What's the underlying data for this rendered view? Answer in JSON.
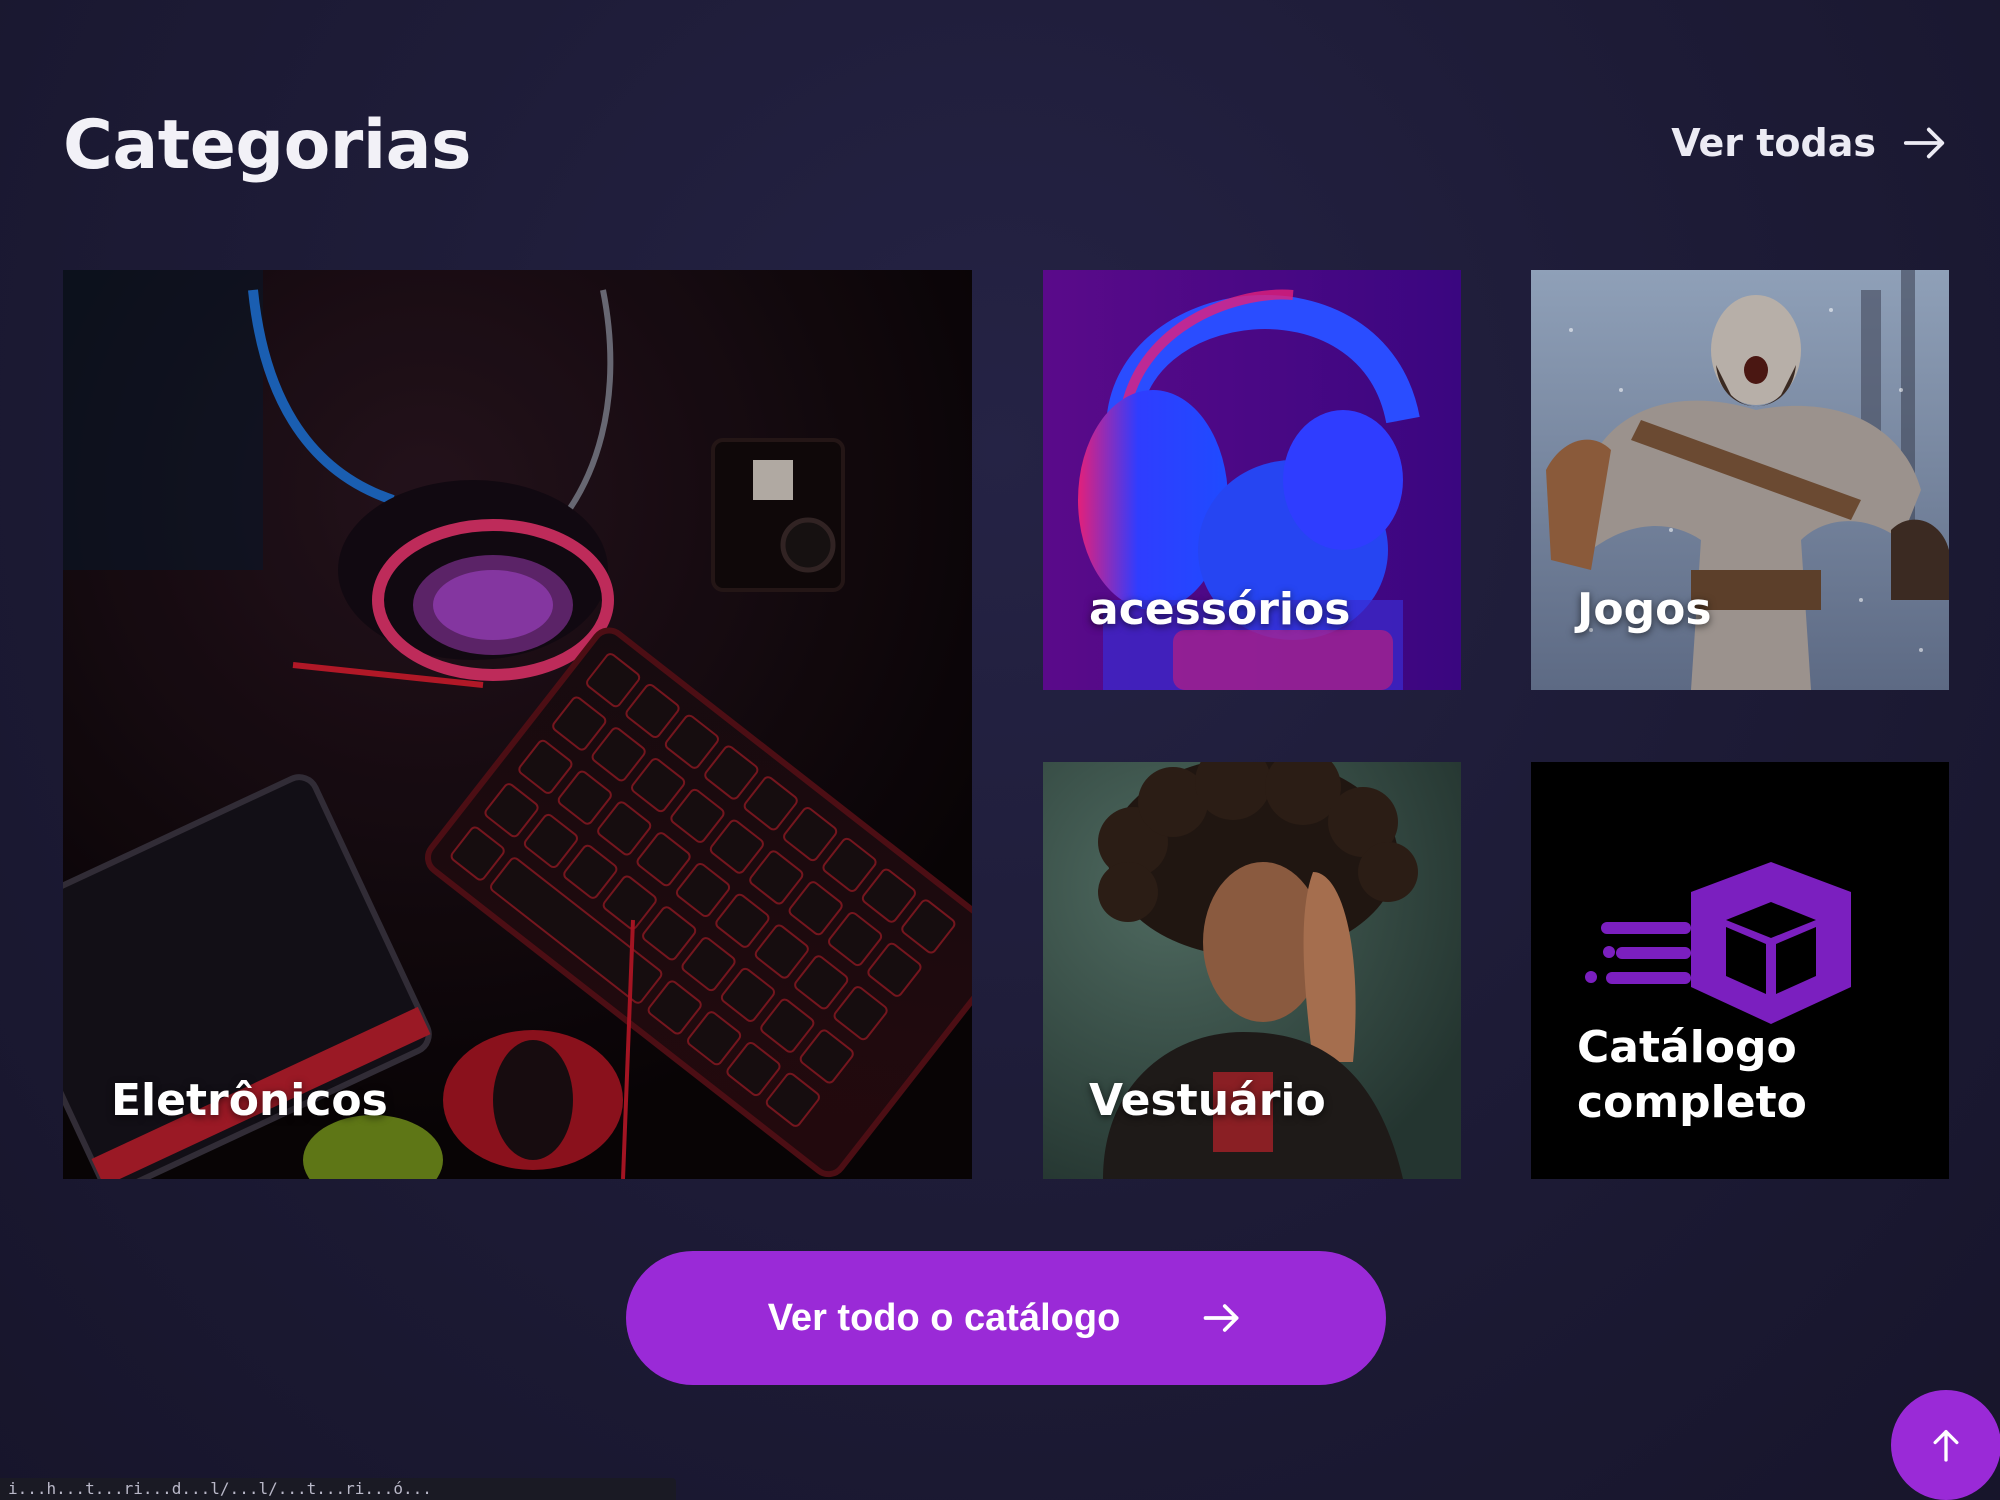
{
  "header": {
    "title": "Categorias",
    "view_all_label": "Ver todas"
  },
  "categories": [
    {
      "label": "Eletrônicos"
    },
    {
      "label": "acessórios"
    },
    {
      "label": "Jogos"
    },
    {
      "label": "Vestuário"
    },
    {
      "label_line1": "Catálogo",
      "label_line2": "completo"
    }
  ],
  "cta": {
    "label": "Ver todo o catálogo"
  },
  "status_bar": {
    "text": "i...h...t...ri...d...l/...l/...t...ri...ó..."
  },
  "icons": {
    "view_all": "arrow-right-icon",
    "cta": "arrow-right-icon",
    "scroll_top": "arrow-up-icon"
  },
  "colors": {
    "background": "#1e1c38",
    "accent": "#9a2ad7",
    "text": "#f2f1f7"
  }
}
